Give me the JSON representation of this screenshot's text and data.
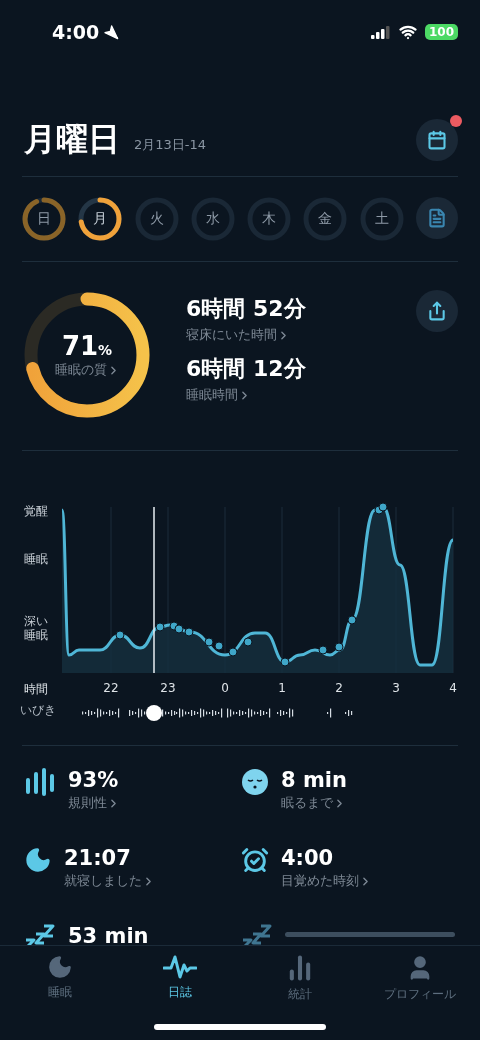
{
  "status_bar": {
    "time": "4:00",
    "battery": "100"
  },
  "header": {
    "title": "月曜日",
    "date_range": "2月13日-14",
    "calendar_badge": true
  },
  "days": [
    {
      "kind": "past",
      "label": "日",
      "selected": false
    },
    {
      "kind": "recorded",
      "label": "月",
      "selected": true
    },
    {
      "kind": "empty",
      "label": "火",
      "selected": false
    },
    {
      "kind": "empty",
      "label": "水",
      "selected": false
    },
    {
      "kind": "empty",
      "label": "木",
      "selected": false
    },
    {
      "kind": "empty",
      "label": "金",
      "selected": false
    },
    {
      "kind": "empty",
      "label": "土",
      "selected": false
    }
  ],
  "quality": {
    "value": "71",
    "unit": "%",
    "label": "睡眠の質"
  },
  "durations": [
    {
      "value": "6時間 52分",
      "label": "寝床にいた時間"
    },
    {
      "value": "6時間 12分",
      "label": "睡眠時間"
    }
  ],
  "sleep_graph": {
    "y_labels": [
      "覚醒",
      "睡眠",
      "深い睡眠"
    ],
    "x_title": "時間",
    "x_labels": [
      "22",
      "23",
      "0",
      "1",
      "2",
      "3",
      "4"
    ],
    "snore_label": "いびき"
  },
  "stats": [
    {
      "kind": "regularity",
      "value": "93%",
      "label": "規則性"
    },
    {
      "kind": "fell_asleep",
      "value": "8 min",
      "label": "眠るまで"
    },
    {
      "kind": "bedtime",
      "value": "21:07",
      "label": "就寝しました"
    },
    {
      "kind": "wakeup",
      "value": "4:00",
      "label": "目覚めた時刻"
    },
    {
      "kind": "snooze",
      "value": "53 min"
    },
    {
      "kind": "loading"
    }
  ],
  "tabs": [
    {
      "kind": "sleep",
      "label": "睡眠",
      "selected": false
    },
    {
      "kind": "journal",
      "label": "日誌",
      "selected": true
    },
    {
      "kind": "stats",
      "label": "統計",
      "selected": false
    },
    {
      "kind": "profile",
      "label": "プロフィール",
      "selected": false
    }
  ]
}
